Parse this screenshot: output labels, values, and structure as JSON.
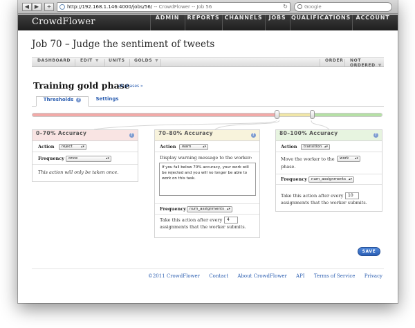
{
  "browser": {
    "url_host": "http://192.168.1.146",
    "url_path": ":4000/jobs/56/",
    "page_title": " -- CrowdFlower -- Job 56",
    "search_placeholder": "Google"
  },
  "app": {
    "logo": "CrowdFlower",
    "nav": [
      "ADMIN",
      "REPORTS",
      "CHANNELS",
      "JOBS",
      "QUALIFICATIONS",
      "ACCOUNT"
    ]
  },
  "job": {
    "title": "Job 70 – Judge the sentiment of tweets"
  },
  "subnav": {
    "left": [
      {
        "label": "DASHBOARD",
        "caret": false
      },
      {
        "label": "EDIT",
        "caret": true
      },
      {
        "label": "UNITS",
        "caret": false
      },
      {
        "label": "GOLDS",
        "caret": true
      }
    ],
    "order_label": "ORDER",
    "order_value": "NOT ORDERED"
  },
  "phase": {
    "title": "Training gold phase",
    "all_phases_link": "all phases »"
  },
  "tabs": {
    "thresholds": "Thresholds",
    "settings": "Settings",
    "help": "?"
  },
  "slider": {
    "thresholds_percent": [
      70,
      80
    ],
    "colors": {
      "low": "#f2aaa8",
      "mid": "#f0e6a8",
      "high": "#b6e0a6"
    }
  },
  "panels": {
    "low": {
      "heading": "0–70% Accuracy",
      "action_label": "Action",
      "action_value": "reject",
      "frequency_label": "Frequency",
      "frequency_value": "once",
      "note": "This action will only be taken once."
    },
    "mid": {
      "heading": "70–80% Accuracy",
      "action_label": "Action",
      "action_value": "warn",
      "message_label": "Display warning message to the worker:",
      "message_value": "If you fall below 70% accuracy, your work will be rejected and you will no longer be able to work on this task.",
      "frequency_label": "Frequency",
      "frequency_value": "num_assignments",
      "after_every_prefix": "Take this action after every",
      "after_every_value": "4",
      "after_every_suffix": "assignments that the worker submits."
    },
    "high": {
      "heading": "80–100% Accuracy",
      "action_label": "Action",
      "action_value": "transition",
      "move_prefix": "Move the worker to the",
      "move_value": "work",
      "move_suffix": "phase.",
      "frequency_label": "Frequency",
      "frequency_value": "num_assignments",
      "after_every_prefix": "Take this action after every",
      "after_every_value": "10",
      "after_every_suffix": "assignments that the worker submits."
    },
    "colors": {
      "low_head": "#f9e4e3",
      "mid_head": "#f8f3dc",
      "high_head": "#e7f4e0"
    }
  },
  "save_label": "SAVE",
  "footer": [
    "©2011 CrowdFlower",
    "Contact",
    "About CrowdFlower",
    "API",
    "Terms of Service",
    "Privacy"
  ]
}
